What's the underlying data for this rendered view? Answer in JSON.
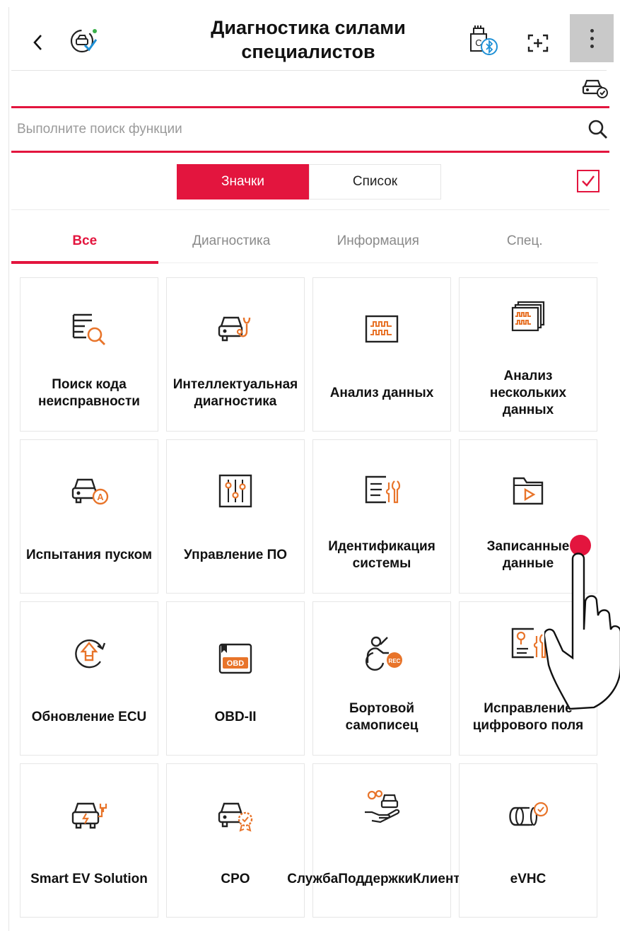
{
  "header": {
    "title": "Диагностика силами специалистов",
    "back_icon": "chevron-left-icon",
    "brand_icon": "car-check-icon",
    "vci_icon": "vci-bluetooth-icon",
    "screenshot_icon": "screenshot-icon",
    "more_icon": "more-vertical-icon"
  },
  "vehicle_status_icon": "vehicle-status-icon",
  "search": {
    "placeholder": "Выполните поиск функции",
    "value": ""
  },
  "view_toggle": {
    "icons_label": "Значки",
    "list_label": "Список",
    "selected": "Значки"
  },
  "select_checkbox": {
    "checked": true
  },
  "tabs": [
    {
      "label": "Все",
      "active": true
    },
    {
      "label": "Диагностика",
      "active": false
    },
    {
      "label": "Информация",
      "active": false
    },
    {
      "label": "Спец.",
      "active": false
    }
  ],
  "tiles": [
    {
      "label": "Поиск кода неисправности",
      "icon": "dtc-search-icon"
    },
    {
      "label": "Интеллектуальная диагностика",
      "icon": "car-stethoscope-icon"
    },
    {
      "label": "Анализ данных",
      "icon": "data-waveform-icon"
    },
    {
      "label": "Анализ нескольких данных",
      "icon": "multi-data-icon"
    },
    {
      "label": "Испытания пуском",
      "icon": "car-actuation-icon"
    },
    {
      "label": "Управление ПО",
      "icon": "sliders-icon"
    },
    {
      "label": "Идентификация системы",
      "icon": "system-id-icon"
    },
    {
      "label": "Записанные данные",
      "icon": "folder-play-icon"
    },
    {
      "label": "Обновление ECU",
      "icon": "ecu-update-icon"
    },
    {
      "label": "OBD-II",
      "icon": "obd-icon"
    },
    {
      "label": "Бортовой самописец",
      "icon": "driver-rec-icon"
    },
    {
      "label": "Исправление цифрового поля",
      "icon": "field-fix-icon"
    },
    {
      "label": "Smart EV Solution",
      "icon": "ev-car-icon"
    },
    {
      "label": "CPO",
      "icon": "car-badge-icon"
    },
    {
      "label": "СлужбаПоддержкиКлиентов",
      "icon": "customer-support-icon"
    },
    {
      "label": "eVHC",
      "icon": "evhc-icon"
    }
  ],
  "colors": {
    "accent": "#e3153e",
    "icon_orange": "#e8742a",
    "text": "#111111",
    "muted": "#8a8a8a"
  }
}
